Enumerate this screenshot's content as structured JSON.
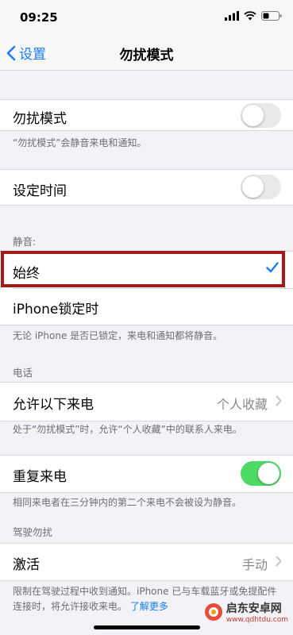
{
  "status": {
    "time": "09:25"
  },
  "nav": {
    "back_label": "设置",
    "title": "勿扰模式"
  },
  "dnd": {
    "label": "勿扰模式",
    "enabled": false,
    "note": "“勿扰模式”会静音来电和通知。"
  },
  "scheduled": {
    "label": "设定时间",
    "enabled": false
  },
  "silence": {
    "header": "静音:",
    "options": [
      {
        "label": "始终",
        "selected": true
      },
      {
        "label": "iPhone锁定时",
        "selected": false
      }
    ],
    "note": "无论 iPhone 是否已锁定，来电和通知都将静音。"
  },
  "phone": {
    "header": "电话",
    "allow_calls": {
      "label": "允许以下来电",
      "value": "个人收藏"
    },
    "note": "处于“勿扰模式”时，允许“个人收藏”中的联系人来电。",
    "repeated": {
      "label": "重复来电",
      "enabled": true
    },
    "repeated_note": "相同来电者在三分钟内的第二个来电不会被设为静音。"
  },
  "driving": {
    "header": "驾驶勿扰",
    "activate": {
      "label": "激活",
      "value": "手动"
    },
    "note": "限制在驾驶过程中收到通知。iPhone 已与车载蓝牙或免提配件连接时，将允许接收来电。",
    "link": "了解更多"
  },
  "watermark": {
    "brand": "启东安卓网",
    "url": "www.qdhtdu.com"
  },
  "colors": {
    "accent": "#1a7cf5",
    "toggle_on": "#4cd964",
    "highlight": "#a31b1b"
  }
}
